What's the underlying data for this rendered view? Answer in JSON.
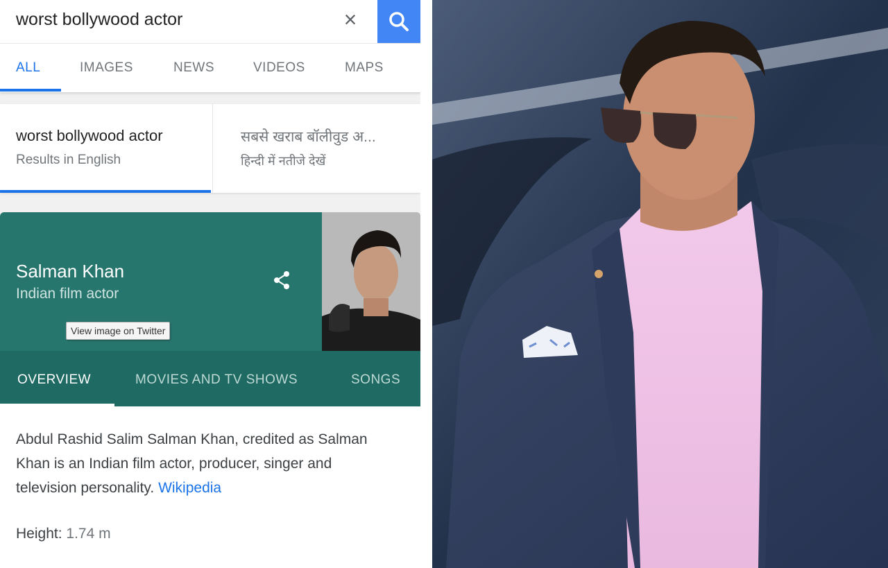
{
  "search": {
    "query": "worst bollywood actor"
  },
  "tabs": [
    "ALL",
    "IMAGES",
    "NEWS",
    "VIDEOS",
    "MAPS"
  ],
  "language_cards": {
    "english": {
      "title": "worst bollywood actor",
      "subtitle": "Results in English"
    },
    "hindi": {
      "title": "सबसे खराब बॉलीवुड अ...",
      "subtitle": "हिन्दी में नतीजे देखें"
    }
  },
  "knowledge_panel": {
    "name": "Salman Khan",
    "description": "Indian film actor",
    "tooltip": "View image on Twitter",
    "tabs": [
      "OVERVIEW",
      "MOVIES AND TV SHOWS",
      "SONGS"
    ],
    "summary": "Abdul Rashid Salim Salman Khan, credited as Salman Khan is an Indian film actor, producer, singer and television personality.",
    "source_link": "Wikipedia",
    "height_label": "Height:",
    "height_value": "1.74 m"
  },
  "colors": {
    "accent_blue": "#1a73e8",
    "search_button": "#4285f4",
    "panel_teal": "#27766e"
  }
}
